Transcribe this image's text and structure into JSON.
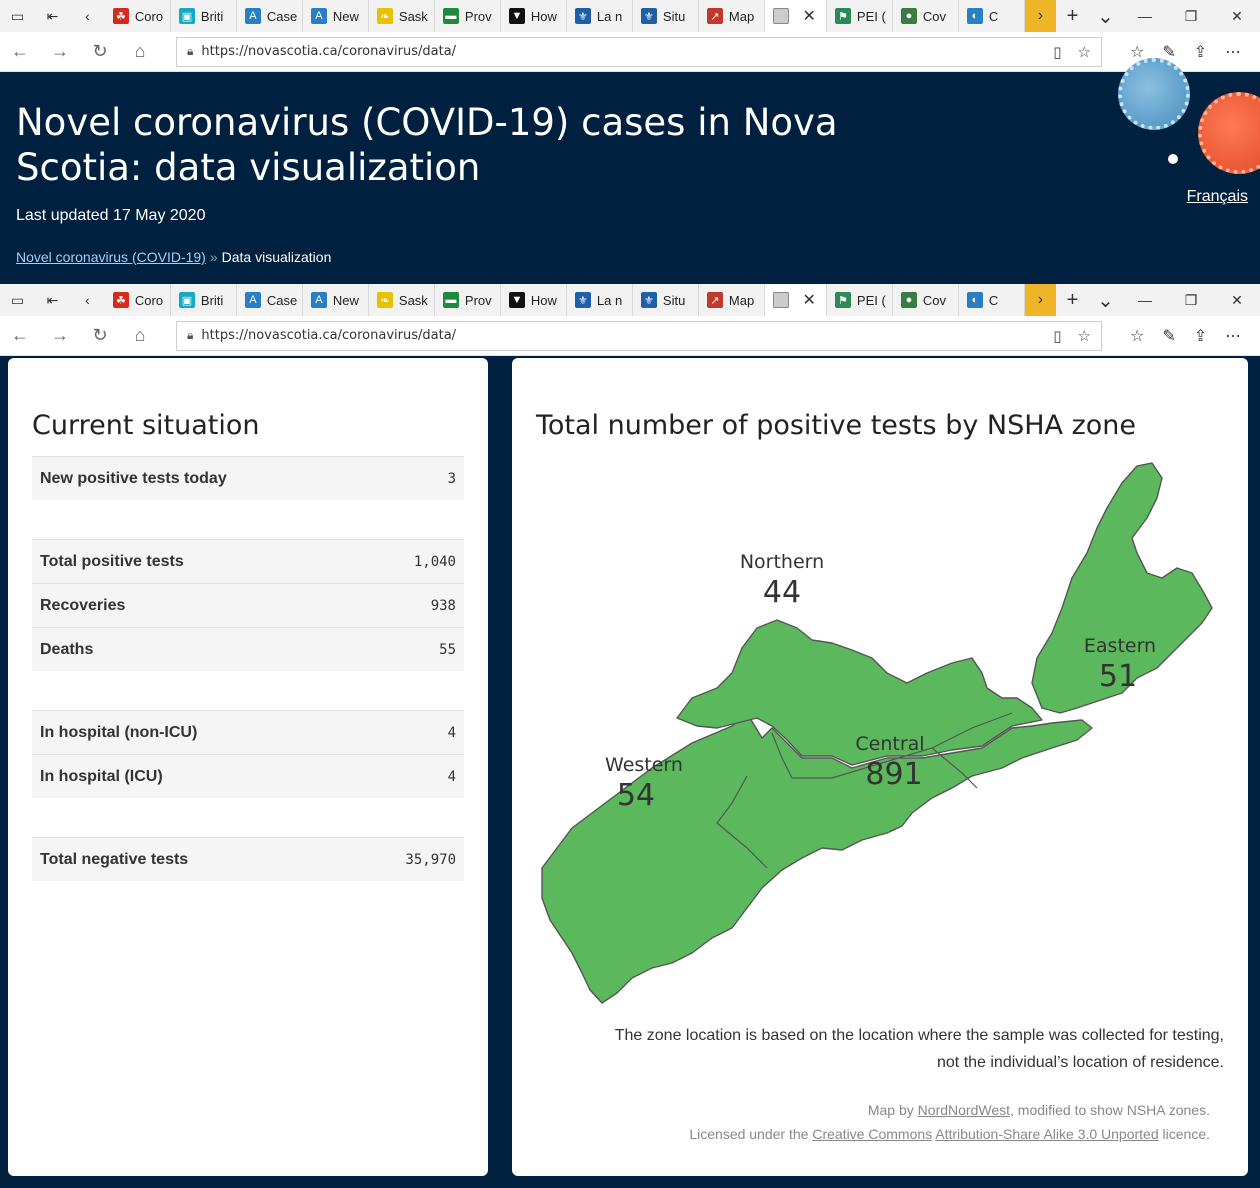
{
  "browser": {
    "tabs": [
      {
        "label": "Coro",
        "color": "#d52b1e",
        "glyph": "☘"
      },
      {
        "label": "Briti",
        "color": "#14a9c6",
        "glyph": "▣"
      },
      {
        "label": "Case",
        "color": "#2a7fc4",
        "glyph": "A"
      },
      {
        "label": "New",
        "color": "#2a7fc4",
        "glyph": "A"
      },
      {
        "label": "Sask",
        "color": "#e8c200",
        "glyph": "❧"
      },
      {
        "label": "Prov",
        "color": "#1e8a3c",
        "glyph": "▬"
      },
      {
        "label": "How",
        "color": "#111111",
        "glyph": "▼"
      },
      {
        "label": "La n",
        "color": "#1f5fa8",
        "glyph": "⚜"
      },
      {
        "label": "Situ",
        "color": "#1f5fa8",
        "glyph": "⚜"
      },
      {
        "label": "Map",
        "color": "#c0392b",
        "glyph": "↗"
      },
      {
        "label": "PEI (",
        "color": "#2b8a5a",
        "glyph": "⚑"
      },
      {
        "label": "Cov",
        "color": "#3a7d44",
        "glyph": "●"
      },
      {
        "label": "C",
        "color": "#2a7fc4",
        "glyph": "◐"
      }
    ],
    "url": "https://novascotia.ca/coronavirus/data/"
  },
  "header": {
    "title": "Novel coronavirus (COVID-19) cases in Nova Scotia: data visualization",
    "updated": "Last updated 17 May 2020",
    "breadcrumb_link": "Novel coronavirus (COVID-19)",
    "breadcrumb_sep": "»",
    "breadcrumb_current": "Data visualization",
    "language_link": "Français"
  },
  "situation": {
    "title": "Current situation",
    "rows": [
      {
        "label": "New positive tests today",
        "value": "3"
      },
      {
        "label": "Total positive tests",
        "value": "1,040"
      },
      {
        "label": "Recoveries",
        "value": "938"
      },
      {
        "label": "Deaths",
        "value": "55"
      },
      {
        "label": "In hospital (non-ICU)",
        "value": "4"
      },
      {
        "label": "In hospital (ICU)",
        "value": "4"
      },
      {
        "label": "Total negative tests",
        "value": "35,970"
      }
    ]
  },
  "map": {
    "title": "Total number of positive tests by NSHA zone",
    "fill_color": "#5cb85c",
    "zones": [
      {
        "name": "Northern",
        "count": "44"
      },
      {
        "name": "Eastern",
        "count": "51"
      },
      {
        "name": "Central",
        "count": "891"
      },
      {
        "name": "Western",
        "count": "54"
      }
    ],
    "note_line1": "The zone location is based on the location where the sample was collected for testing,",
    "note_line2": "not the individual’s location of residence.",
    "credit_prefix": "Map by",
    "credit_author": "NordNordWest",
    "credit_suffix": ", modified to show NSHA zones.",
    "license_prefix": "Licensed under the",
    "license_cc": "Creative Commons",
    "license_name": "Attribution-Share Alike 3.0 Unported",
    "license_suffix": "licence."
  }
}
